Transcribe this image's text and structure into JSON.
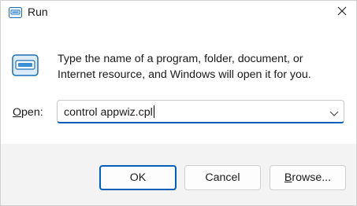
{
  "window": {
    "title": "Run",
    "title_icon": "run-icon",
    "close_icon": "close-icon"
  },
  "content": {
    "description_line1": "Type the name of a program, folder, document, or",
    "description_line2": "Internet resource, and Windows will open it for you.",
    "open_label_mnemonic": "O",
    "open_label_rest": "pen:",
    "open_value": "control appwiz.cpl",
    "dropdown_icon": "chevron-down-icon"
  },
  "buttons": {
    "ok": "OK",
    "cancel": "Cancel",
    "browse_mnemonic": "B",
    "browse_rest": "rowse..."
  },
  "colors": {
    "accent": "#005fb8",
    "titlebar_bg": "#ffffff",
    "footer_bg": "#f3f3f3"
  }
}
